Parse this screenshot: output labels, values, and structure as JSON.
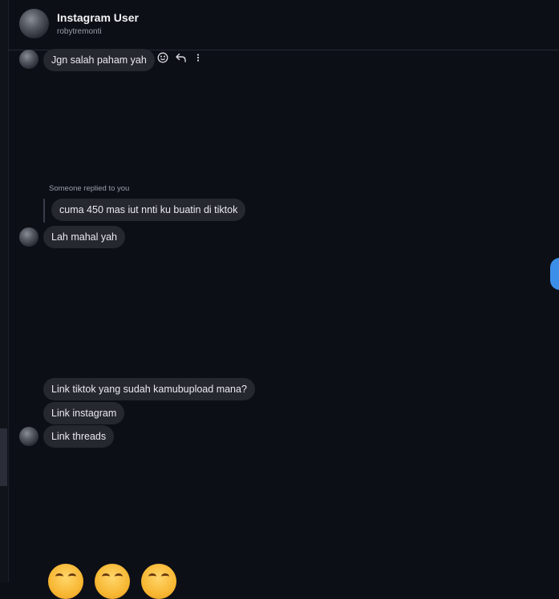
{
  "header": {
    "title": "Instagram User",
    "username": "robytremonti"
  },
  "messages": {
    "m1": "Jgn salah paham yah",
    "reply_label": "Someone replied to you",
    "quoted": "cuma 450 mas iut nnti ku buatin di tiktok",
    "m2": "Lah mahal yah",
    "m3": "Link tiktok yang sudah kamubupload mana?",
    "m4": "Link instagram",
    "m5": "Link threads"
  },
  "icons": {
    "react": "smile-icon",
    "reply": "reply-icon",
    "more": "more-icon"
  },
  "colors": {
    "background": "#0d0f17",
    "bubble": "#262830",
    "accent": "#3b8fe8"
  }
}
